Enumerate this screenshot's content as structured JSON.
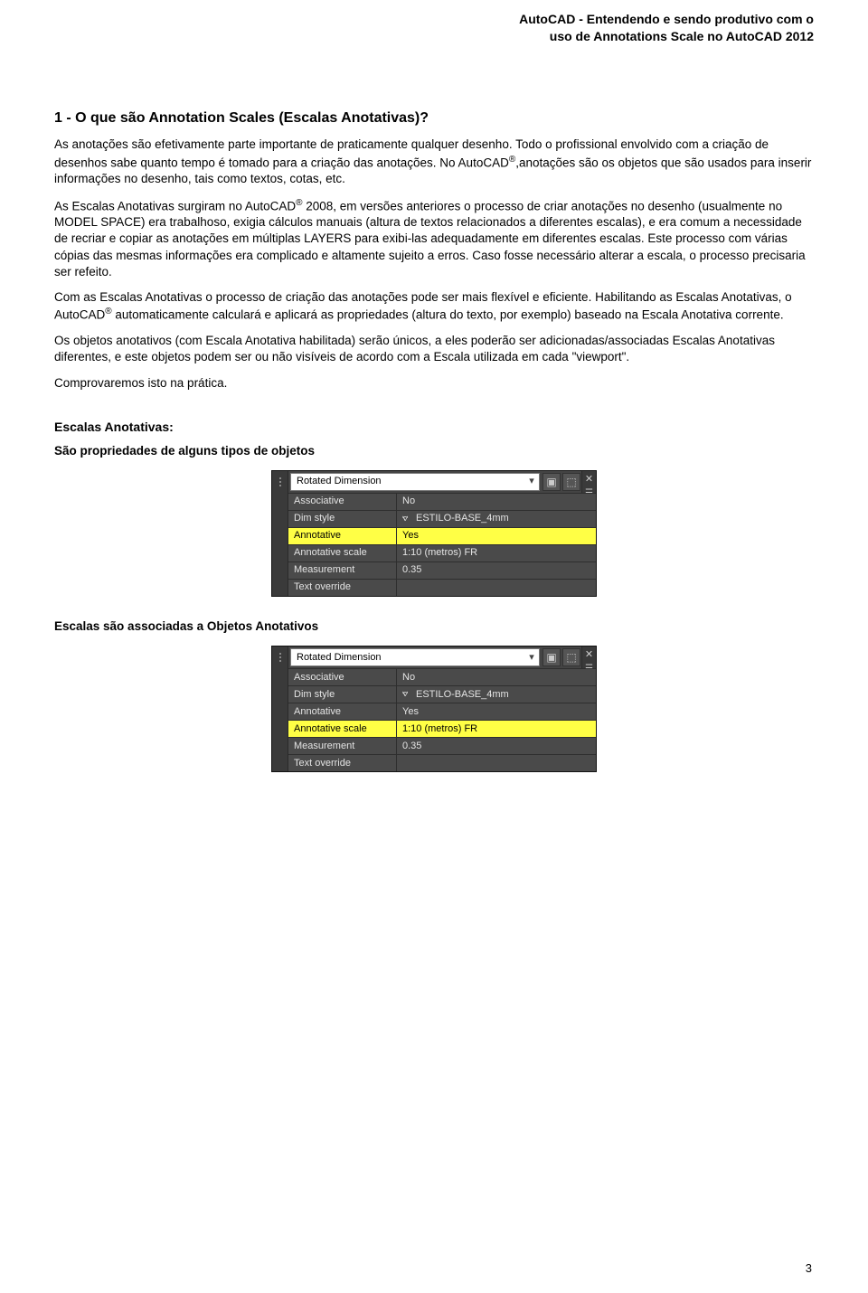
{
  "header": {
    "line1": "AutoCAD - Entendendo e sendo produtivo com o",
    "line2": "uso de Annotations Scale no AutoCAD 2012"
  },
  "heading": "1 - O que são Annotation Scales (Escalas Anotativas)?",
  "p1a": "As anotações são efetivamente parte importante de praticamente qualquer desenho. Todo o profissional envolvido com a criação de desenhos sabe quanto tempo é tomado para a criação das anotações. No AutoCAD",
  "p1b": ",anotações são os objetos que são usados para inserir informações no desenho, tais como textos, cotas, etc.",
  "p2a": "As Escalas Anotativas surgiram no AutoCAD",
  "p2b": " 2008, em versões anteriores o processo de criar anotações no desenho (usualmente no MODEL SPACE) era trabalhoso, exigia cálculos manuais (altura de textos relacionados a diferentes escalas), e era comum a necessidade de recriar e copiar as anotações em múltiplas LAYERS para exibi-las adequadamente em diferentes escalas. Este processo com várias cópias das mesmas informações era complicado e altamente sujeito a erros. Caso fosse necessário alterar a escala, o processo precisaria ser refeito.",
  "p3a": "Com as Escalas Anotativas o processo de criação das anotações pode ser mais flexível e eficiente. Habilitando as Escalas Anotativas, o AutoCAD",
  "p3b": " automaticamente calculará e aplicará as propriedades (altura do texto, por exemplo) baseado na Escala Anotativa corrente.",
  "p4": "Os objetos anotativos (com Escala Anotativa habilitada) serão únicos, a eles poderão ser adicionadas/associadas Escalas Anotativas diferentes, e este objetos podem ser ou não visíveis de acordo com a Escala utilizada em cada \"viewport\".",
  "p5": "Comprovaremos isto na prática.",
  "sub1": "Escalas Anotativas:",
  "sub1b": "São propriedades de alguns tipos de objetos",
  "sub2": "Escalas são associadas a Objetos Anotativos",
  "reg": "®",
  "panel1": {
    "title": "Rotated Dimension",
    "highlight": "Annotative",
    "rows": [
      {
        "label": "Associative",
        "value": "No"
      },
      {
        "label": "Dim style",
        "value": "ESTILO-BASE_4mm",
        "icon": true
      },
      {
        "label": "Annotative",
        "value": "Yes"
      },
      {
        "label": "Annotative scale",
        "value": "1:10 (metros) FR"
      },
      {
        "label": "Measurement",
        "value": "0.35"
      },
      {
        "label": "Text override",
        "value": ""
      }
    ]
  },
  "panel2": {
    "title": "Rotated Dimension",
    "highlight": "Annotative scale",
    "rows": [
      {
        "label": "Associative",
        "value": "No"
      },
      {
        "label": "Dim style",
        "value": "ESTILO-BASE_4mm",
        "icon": true
      },
      {
        "label": "Annotative",
        "value": "Yes"
      },
      {
        "label": "Annotative scale",
        "value": "1:10 (metros) FR"
      },
      {
        "label": "Measurement",
        "value": "0.35"
      },
      {
        "label": "Text override",
        "value": ""
      }
    ]
  },
  "pagenum": "3"
}
